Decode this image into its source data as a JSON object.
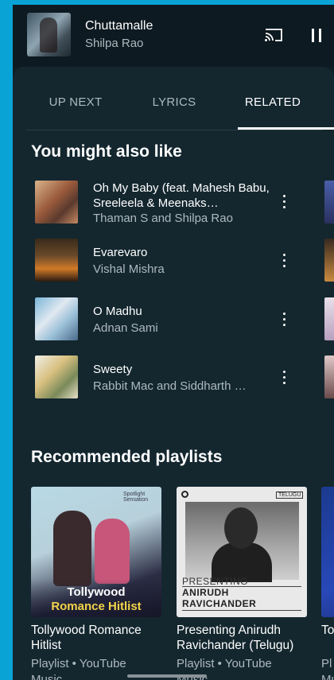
{
  "now_playing": {
    "title": "Chuttamalle",
    "artist": "Shilpa Rao"
  },
  "icons": {
    "cast": "cast-icon",
    "pause": "pause-icon",
    "more": "more-vert-icon"
  },
  "tabs": [
    {
      "label": "UP NEXT",
      "active": false
    },
    {
      "label": "LYRICS",
      "active": false
    },
    {
      "label": "RELATED",
      "active": true
    }
  ],
  "related": {
    "section_title": "You might also like",
    "songs": [
      {
        "title": "Oh My Baby (feat. Mahesh Babu, Sreeleela & Meenaks…",
        "artist": "Thaman S and Shilpa Rao"
      },
      {
        "title": "Evarevaro",
        "artist": "Vishal Mishra"
      },
      {
        "title": "O Madhu",
        "artist": "Adnan Sami"
      },
      {
        "title": "Sweety",
        "artist": "Rabbit Mac and Siddharth …"
      }
    ]
  },
  "playlists": {
    "section_title": "Recommended playlists",
    "items": [
      {
        "title": "Tollywood Romance Hitlist",
        "subtitle": "Playlist • YouTube Music",
        "art_line1": "Tollywood",
        "art_line2": "Romance Hitlist",
        "art_tag": "Spotlight Sensation"
      },
      {
        "title": "Presenting Anirudh Ravichander (Telugu)",
        "subtitle": "Playlist • YouTube Music",
        "art_presenting": "PRESENTING",
        "art_name1": "ANIRUDH",
        "art_name2": "RAVICHANDER",
        "art_badge": "TELUGU"
      },
      {
        "title": "To",
        "subtitle": "Pl Mu"
      }
    ]
  },
  "colors": {
    "background": "#14272f",
    "accent_border": "#0aa3d6",
    "secondary_text": "#aeb9bf"
  }
}
